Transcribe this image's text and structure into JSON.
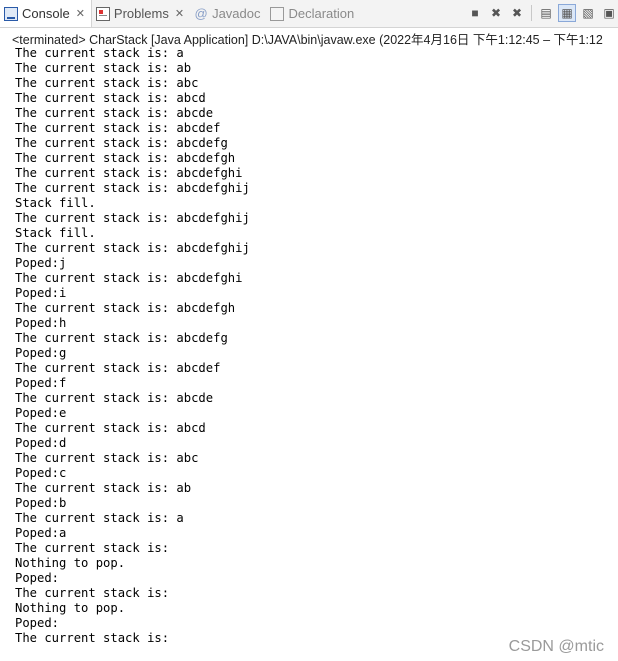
{
  "tabs": [
    {
      "label": "Console",
      "icon": "console-icon",
      "state": "active",
      "closable": true
    },
    {
      "label": "Problems",
      "icon": "problems-icon",
      "state": "inactive",
      "closable": true
    },
    {
      "label": "Javadoc",
      "icon": "at-icon",
      "state": "dim",
      "closable": false
    },
    {
      "label": "Declaration",
      "icon": "declaration-icon",
      "state": "dim",
      "closable": false
    }
  ],
  "toolbar_icons": [
    "terminate-icon",
    "remove-launch-icon",
    "remove-all-terminated-icon",
    "clear-console-icon",
    "scroll-lock-icon",
    "word-wrap-icon",
    "pin-console-icon"
  ],
  "status_line": "<terminated> CharStack [Java Application] D:\\JAVA\\bin\\javaw.exe  (2022年4月16日 下午1:12:45 – 下午1:12",
  "console_lines": [
    "The current stack is: a",
    "The current stack is: ab",
    "The current stack is: abc",
    "The current stack is: abcd",
    "The current stack is: abcde",
    "The current stack is: abcdef",
    "The current stack is: abcdefg",
    "The current stack is: abcdefgh",
    "The current stack is: abcdefghi",
    "The current stack is: abcdefghij",
    "Stack fill.",
    "The current stack is: abcdefghij",
    "Stack fill.",
    "The current stack is: abcdefghij",
    "Poped:j",
    "The current stack is: abcdefghi",
    "Poped:i",
    "The current stack is: abcdefgh",
    "Poped:h",
    "The current stack is: abcdefg",
    "Poped:g",
    "The current stack is: abcdef",
    "Poped:f",
    "The current stack is: abcde",
    "Poped:e",
    "The current stack is: abcd",
    "Poped:d",
    "The current stack is: abc",
    "Poped:c",
    "The current stack is: ab",
    "Poped:b",
    "The current stack is: a",
    "Poped:a",
    "The current stack is: ",
    "Nothing to pop.",
    "Poped:",
    "The current stack is: ",
    "Nothing to pop.",
    "Poped:",
    "The current stack is: "
  ],
  "watermark": "CSDN @mtic"
}
